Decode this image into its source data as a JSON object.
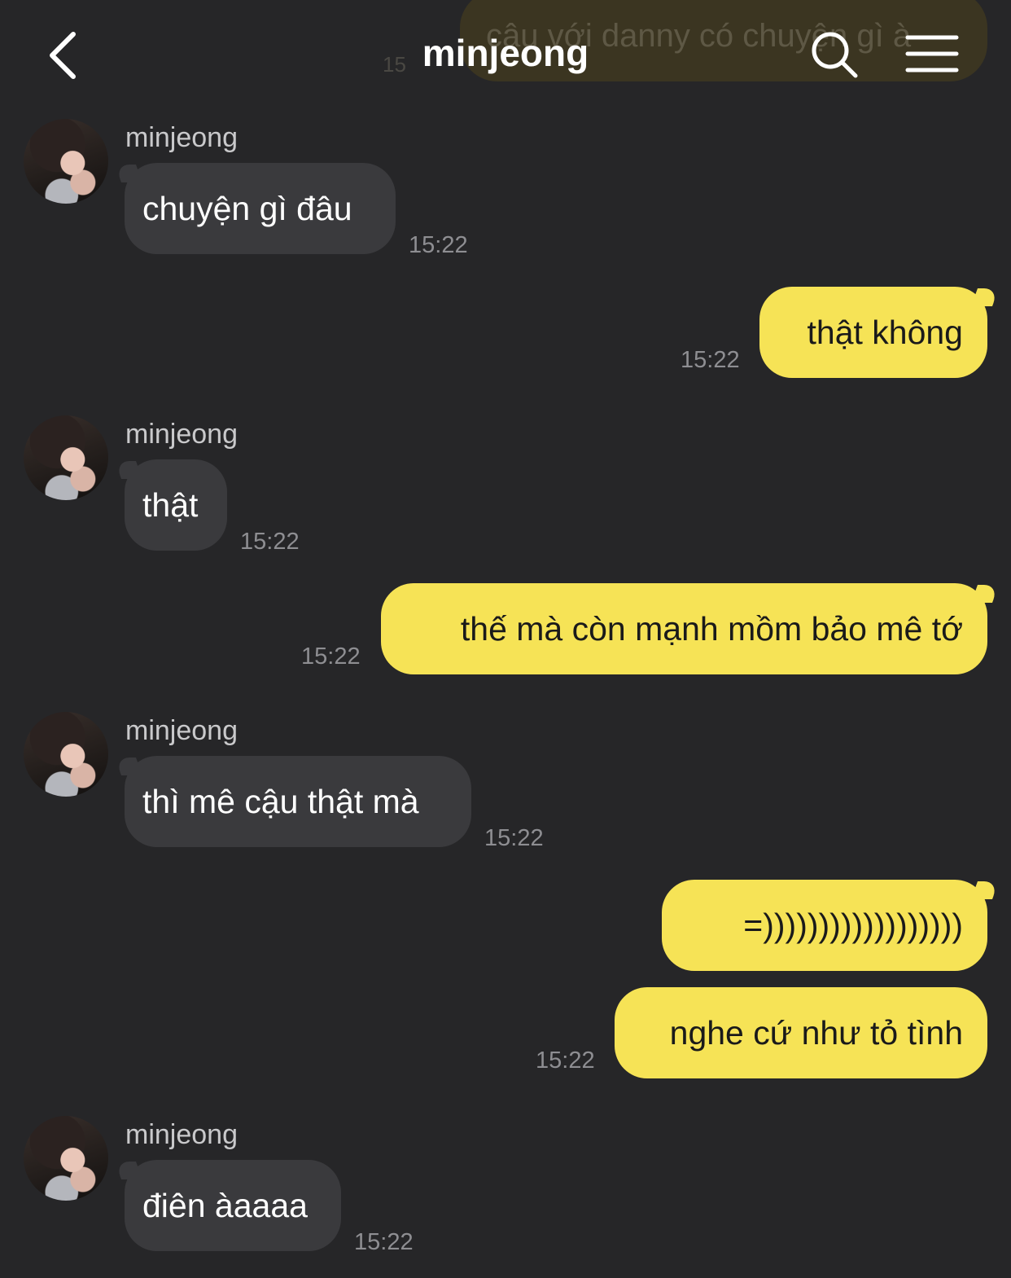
{
  "header": {
    "title": "minjeong",
    "back_icon": "chevron-left-icon",
    "search_icon": "search-icon",
    "menu_icon": "hamburger-menu-icon"
  },
  "pinned_preview": {
    "text": "cậu với danny có chuyện gì à",
    "time": "15"
  },
  "colors": {
    "background": "#262628",
    "incoming_bubble": "#3a3a3d",
    "outgoing_bubble": "#f6e356",
    "timestamp": "#8e8e92"
  },
  "messages": [
    {
      "sender": "minjeong",
      "text": "chuyện gì đâu",
      "time": "15:22"
    },
    {
      "text": "thật không",
      "time": "15:22"
    },
    {
      "sender": "minjeong",
      "text": "thật",
      "time": "15:22"
    },
    {
      "text": "thế mà còn mạnh mồm bảo mê tớ",
      "time": "15:22"
    },
    {
      "sender": "minjeong",
      "text": "thì mê cậu thật mà",
      "time": "15:22"
    },
    {
      "text": "=))))))))))))))))))"
    },
    {
      "text": "nghe cứ như tỏ tình",
      "time": "15:22"
    },
    {
      "sender": "minjeong",
      "text": "điên àaaaa",
      "time": "15:22"
    }
  ]
}
